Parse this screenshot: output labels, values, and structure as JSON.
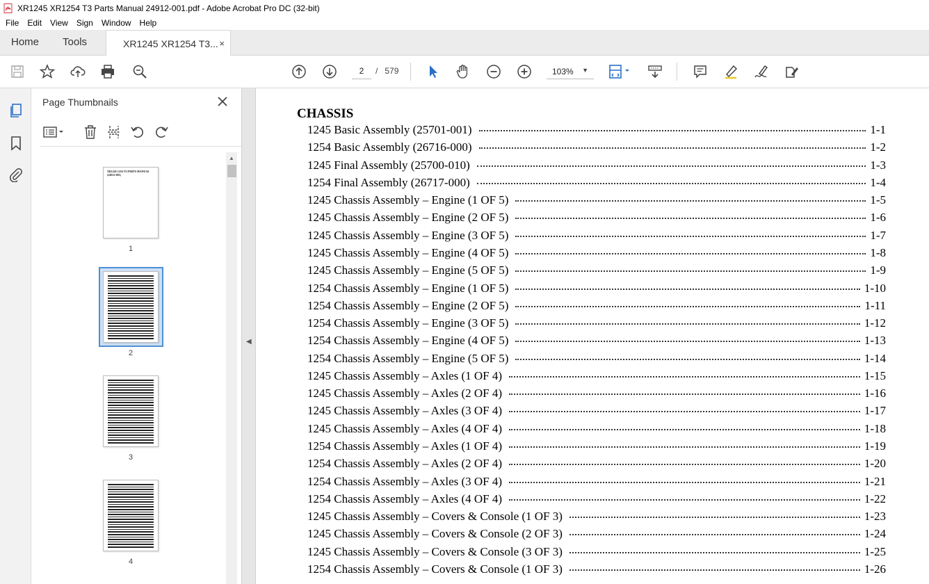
{
  "window": {
    "title": "XR1245 XR1254 T3 Parts Manual 24912-001.pdf - Adobe Acrobat Pro DC (32-bit)"
  },
  "menu": [
    "File",
    "Edit",
    "View",
    "Sign",
    "Window",
    "Help"
  ],
  "tabs": {
    "home": "Home",
    "tools": "Tools",
    "document": "XR1245 XR1254 T3...",
    "close": "×"
  },
  "toolbar": {
    "current_page": "2",
    "page_separator": "/",
    "total_pages": "579",
    "zoom": "103%"
  },
  "thumbnails_panel": {
    "title": "Page Thumbnails",
    "pages": [
      {
        "label": "1",
        "cover_text": "XR1245 1254 T3 PARTS MANUAL (24912-001)"
      },
      {
        "label": "2"
      },
      {
        "label": "3"
      },
      {
        "label": "4"
      }
    ]
  },
  "document": {
    "heading": "CHASSIS",
    "entries": [
      {
        "title": "1245 Basic Assembly (25701-001)",
        "page": "1-1"
      },
      {
        "title": "1254 Basic Assembly (26716-000)",
        "page": "1-2"
      },
      {
        "title": "1245 Final Assembly (25700-010)",
        "page": "1-3"
      },
      {
        "title": "1254 Final Assembly (26717-000)",
        "page": "1-4"
      },
      {
        "title": "1245 Chassis Assembly – Engine (1 OF 5)",
        "page": "1-5"
      },
      {
        "title": "1245 Chassis Assembly – Engine (2 OF 5)",
        "page": "1-6"
      },
      {
        "title": "1245 Chassis Assembly – Engine (3 OF 5)",
        "page": "1-7"
      },
      {
        "title": "1245 Chassis Assembly – Engine (4 OF 5)",
        "page": "1-8"
      },
      {
        "title": "1245 Chassis Assembly – Engine (5 OF 5)",
        "page": "1-9"
      },
      {
        "title": "1254 Chassis Assembly – Engine (1 OF 5)",
        "page": "1-10"
      },
      {
        "title": "1254 Chassis Assembly – Engine (2 OF 5)",
        "page": "1-11"
      },
      {
        "title": "1254 Chassis Assembly – Engine (3 OF 5)",
        "page": "1-12"
      },
      {
        "title": "1254 Chassis Assembly – Engine (4 OF 5)",
        "page": "1-13"
      },
      {
        "title": "1254 Chassis Assembly – Engine (5 OF 5)",
        "page": "1-14"
      },
      {
        "title": "1245 Chassis Assembly – Axles (1 OF 4)",
        "page": "1-15"
      },
      {
        "title": "1245 Chassis Assembly – Axles (2 OF 4)",
        "page": "1-16"
      },
      {
        "title": "1245 Chassis Assembly – Axles (3 OF 4)",
        "page": "1-17"
      },
      {
        "title": "1245 Chassis Assembly – Axles (4 OF 4)",
        "page": "1-18"
      },
      {
        "title": "1254 Chassis Assembly – Axles (1 OF 4)",
        "page": "1-19"
      },
      {
        "title": "1254 Chassis Assembly – Axles (2 OF 4)",
        "page": "1-20"
      },
      {
        "title": "1254 Chassis Assembly – Axles (3 OF 4)",
        "page": "1-21"
      },
      {
        "title": "1254 Chassis Assembly – Axles (4 OF 4)",
        "page": "1-22"
      },
      {
        "title": "1245 Chassis Assembly – Covers & Console (1 OF 3)",
        "page": "1-23"
      },
      {
        "title": "1245 Chassis Assembly – Covers & Console (2 OF 3)",
        "page": "1-24"
      },
      {
        "title": "1245 Chassis Assembly – Covers & Console (3 OF 3)",
        "page": "1-25"
      },
      {
        "title": "1254 Chassis Assembly – Covers & Console (1 OF 3)",
        "page": "1-26"
      }
    ]
  },
  "colors": {
    "accent": "#2b6fc7",
    "acrobat_red": "#d7373f",
    "selection": "#4d8ed6"
  },
  "icons": [
    "pdf-icon",
    "save-icon",
    "star-icon",
    "upload-icon",
    "print-icon",
    "zoom-search-icon",
    "page-up-icon",
    "page-down-icon",
    "select-cursor-icon",
    "hand-icon",
    "zoom-out-icon",
    "zoom-in-icon",
    "fit-page-icon",
    "scroll-mode-icon",
    "comment-icon",
    "highlight-icon",
    "sign-icon",
    "fill-sign-icon",
    "thumbnails-icon",
    "bookmark-icon",
    "attachment-icon",
    "close-icon",
    "options-icon",
    "delete-icon",
    "extract-icon",
    "rotate-left-icon",
    "rotate-right-icon"
  ]
}
